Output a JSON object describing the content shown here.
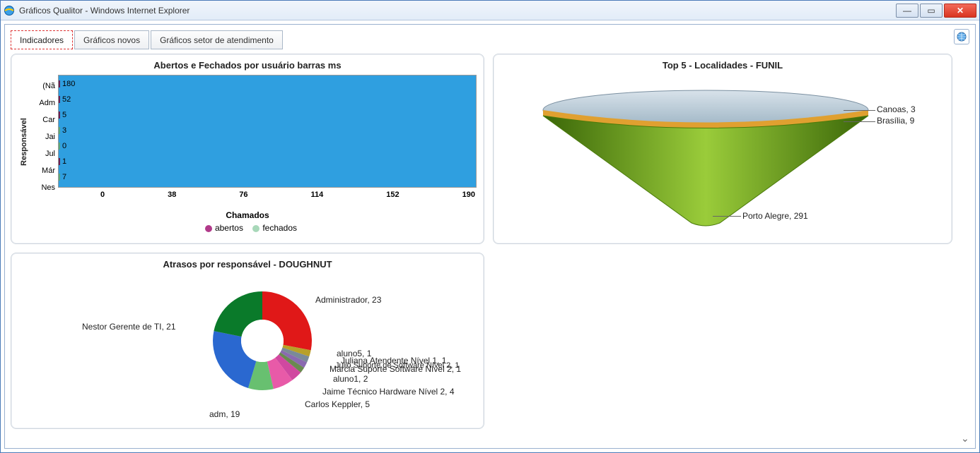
{
  "window": {
    "title": "Gráficos Qualitor - Windows Internet Explorer"
  },
  "tabs": [
    {
      "label": "Indicadores",
      "active": true
    },
    {
      "label": "Gráficos novos",
      "active": false
    },
    {
      "label": "Gráficos setor de atendimento",
      "active": false
    }
  ],
  "panel_bar": {
    "title": "Abertos e Fechados por usuário barras ms",
    "ylabel": "Responsável",
    "xlabel": "Chamados",
    "legend": [
      "abertos",
      "fechados"
    ],
    "xticks": [
      "0",
      "38",
      "76",
      "114",
      "152",
      "190"
    ]
  },
  "panel_funnel": {
    "title": "Top 5 - Localidades - FUNIL",
    "labels": {
      "canoas": "Canoas, 3",
      "brasilia": "Brasília, 9",
      "porto_alegre": "Porto Alegre, 291"
    }
  },
  "panel_donut": {
    "title": "Atrasos por responsável - DOUGHNUT",
    "labels": {
      "admin": "Administrador, 23",
      "nestor": "Nestor Gerente de TI, 21",
      "adm": "adm, 19",
      "carlos": "Carlos Keppler, 5",
      "jaime": "Jaime Técnico Hardware Nível 2, 4",
      "aluno1": "aluno1, 2",
      "marcia": "Márcia Suporte Software Nível 2, 1",
      "juliana": "Juliana Atendente Nível 1, 1",
      "aluno5": "aluno5, 1",
      "julio": "Julio Suporte de Software Nível 2, 1"
    }
  },
  "chart_data": [
    {
      "id": "bar_abertos_fechados",
      "type": "bar",
      "orientation": "horizontal",
      "title": "Abertos e Fechados por usuário barras ms",
      "xlabel": "Chamados",
      "ylabel": "Responsável",
      "xlim": [
        0,
        190
      ],
      "xticks": [
        0,
        38,
        76,
        114,
        152,
        190
      ],
      "categories": [
        "(Nã",
        "Adm",
        "Car",
        "Jai",
        "Jul",
        "Már",
        "Nes"
      ],
      "series": [
        {
          "name": "abertos",
          "color": "#b13a8a",
          "values": [
            180,
            52,
            5,
            null,
            null,
            1,
            null
          ]
        },
        {
          "name": "fechados",
          "color": "#a8d8b9",
          "values": [
            null,
            null,
            null,
            3,
            0,
            null,
            7
          ]
        }
      ],
      "visible_value_labels": {
        "(Nã": 180,
        "Adm": 52,
        "Car": 5,
        "Jai": 3,
        "Jul": 0,
        "Már": 1,
        "Nes": 7
      }
    },
    {
      "id": "funnel_localidades",
      "type": "funnel",
      "title": "Top 5 - Localidades - FUNIL",
      "slices": [
        {
          "name": "Canoas",
          "value": 3,
          "color": "#9fb8c8"
        },
        {
          "name": "Brasília",
          "value": 9,
          "color": "#e0a030"
        },
        {
          "name": "Porto Alegre",
          "value": 291,
          "color": "#6aa514"
        }
      ]
    },
    {
      "id": "donut_atrasos",
      "type": "doughnut",
      "title": "Atrasos por responsável - DOUGHNUT",
      "slices": [
        {
          "name": "Administrador",
          "value": 23,
          "color": "#e01818"
        },
        {
          "name": "aluno5",
          "value": 1,
          "color": "#b8a028"
        },
        {
          "name": "Juliana Atendente Nível 1",
          "value": 1,
          "color": "#7a8a98"
        },
        {
          "name": "Julio Suporte de Software Nível 2",
          "value": 1,
          "color": "#8a6ab0"
        },
        {
          "name": "Márcia Suporte Software Nível 2",
          "value": 1,
          "color": "#6a8a50"
        },
        {
          "name": "aluno1",
          "value": 2,
          "color": "#d048a0"
        },
        {
          "name": "Jaime Técnico Hardware Nível 2",
          "value": 4,
          "color": "#e85aa8"
        },
        {
          "name": "Carlos Keppler",
          "value": 5,
          "color": "#68c070"
        },
        {
          "name": "adm",
          "value": 19,
          "color": "#2a68d0"
        },
        {
          "name": "Nestor Gerente de TI",
          "value": 21,
          "color": "#0a7a2a"
        }
      ]
    }
  ]
}
